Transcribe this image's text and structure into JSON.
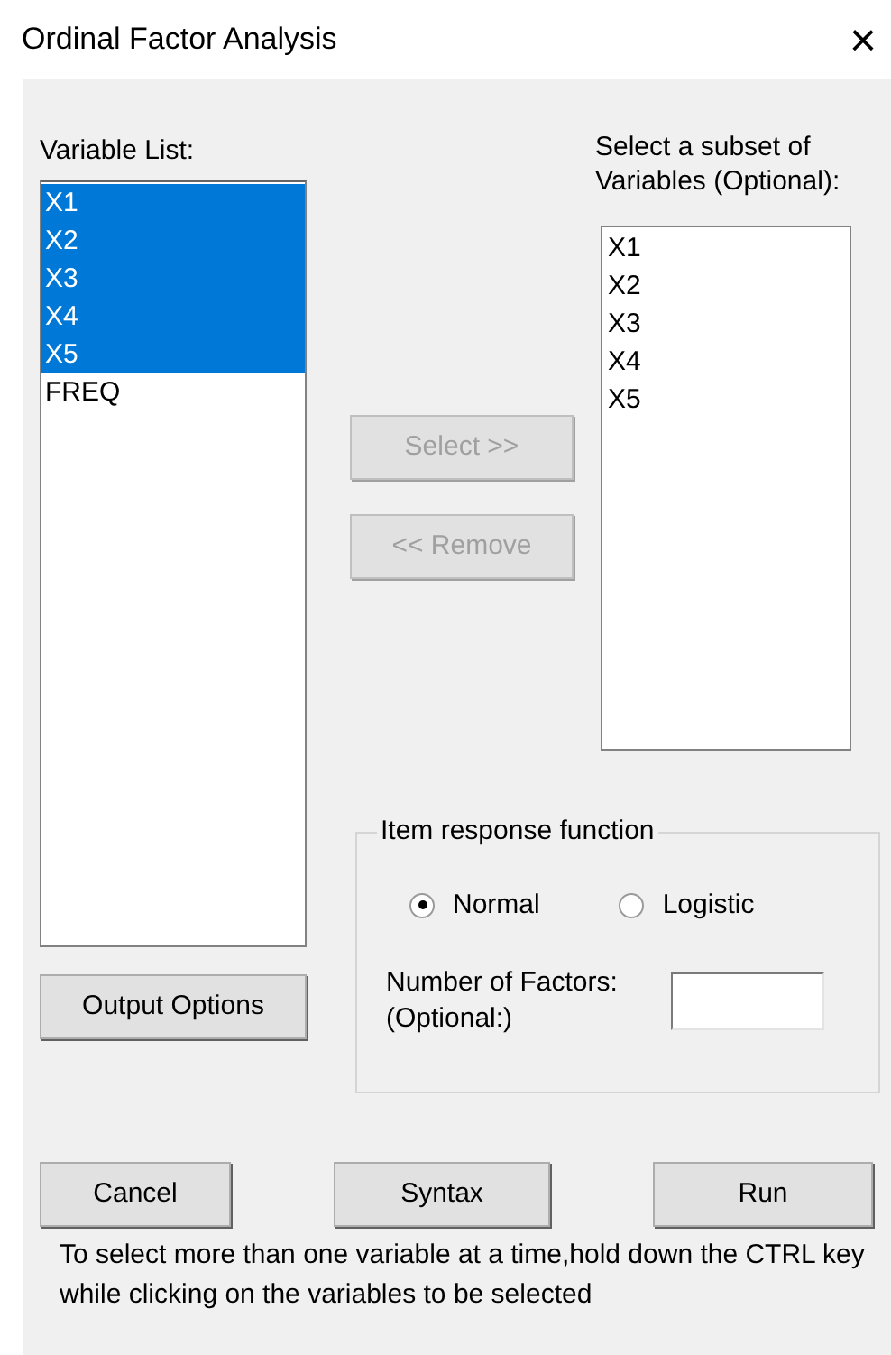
{
  "window": {
    "title": "Ordinal Factor Analysis",
    "close": "×"
  },
  "variable_list": {
    "label": "Variable List:",
    "items": [
      {
        "label": "X1",
        "selected": true
      },
      {
        "label": "X2",
        "selected": true
      },
      {
        "label": "X3",
        "selected": true
      },
      {
        "label": "X4",
        "selected": true
      },
      {
        "label": "X5",
        "selected": true
      },
      {
        "label": "FREQ",
        "selected": false
      }
    ]
  },
  "move_buttons": [
    {
      "label": "Select >>",
      "disabled": true
    },
    {
      "label": "<< Remove",
      "disabled": true
    }
  ],
  "subset_list": {
    "label": "Select a subset of Variables (Optional):",
    "items": [
      "X1",
      "X2",
      "X3",
      "X4",
      "X5"
    ]
  },
  "output_options_button": "Output Options",
  "item_response_function": {
    "legend": "Item response function",
    "options": [
      {
        "label": "Normal",
        "selected": true
      },
      {
        "label": "Logistic",
        "selected": false
      }
    ],
    "factors_label": "Number of Factors: (Optional:)"
  },
  "buttons": [
    "Cancel",
    "Syntax",
    "Run"
  ],
  "hint": "To select more than one variable at a time,hold down the CTRL key while clicking on the variables to be selected"
}
